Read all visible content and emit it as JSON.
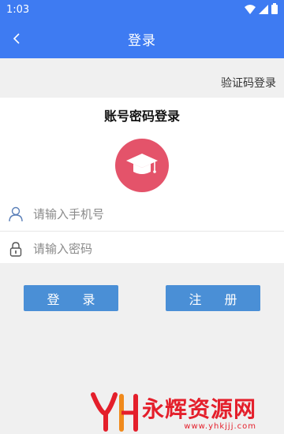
{
  "status_bar": {
    "time": "1:03"
  },
  "app_bar": {
    "title": "登录"
  },
  "sms_login_link": "验证码登录",
  "panel": {
    "title": "账号密码登录",
    "phone_placeholder": "请输入手机号",
    "password_placeholder": "请输入密码"
  },
  "buttons": {
    "login": "登 录",
    "register": "注 册"
  },
  "watermark": {
    "brand": "永辉资源网",
    "url": "www.yhkjjj.com"
  },
  "colors": {
    "primary": "#3e7bf2",
    "button": "#4a8fd6",
    "avatar_bg": "#e4536a",
    "watermark": "#e41f2b"
  }
}
